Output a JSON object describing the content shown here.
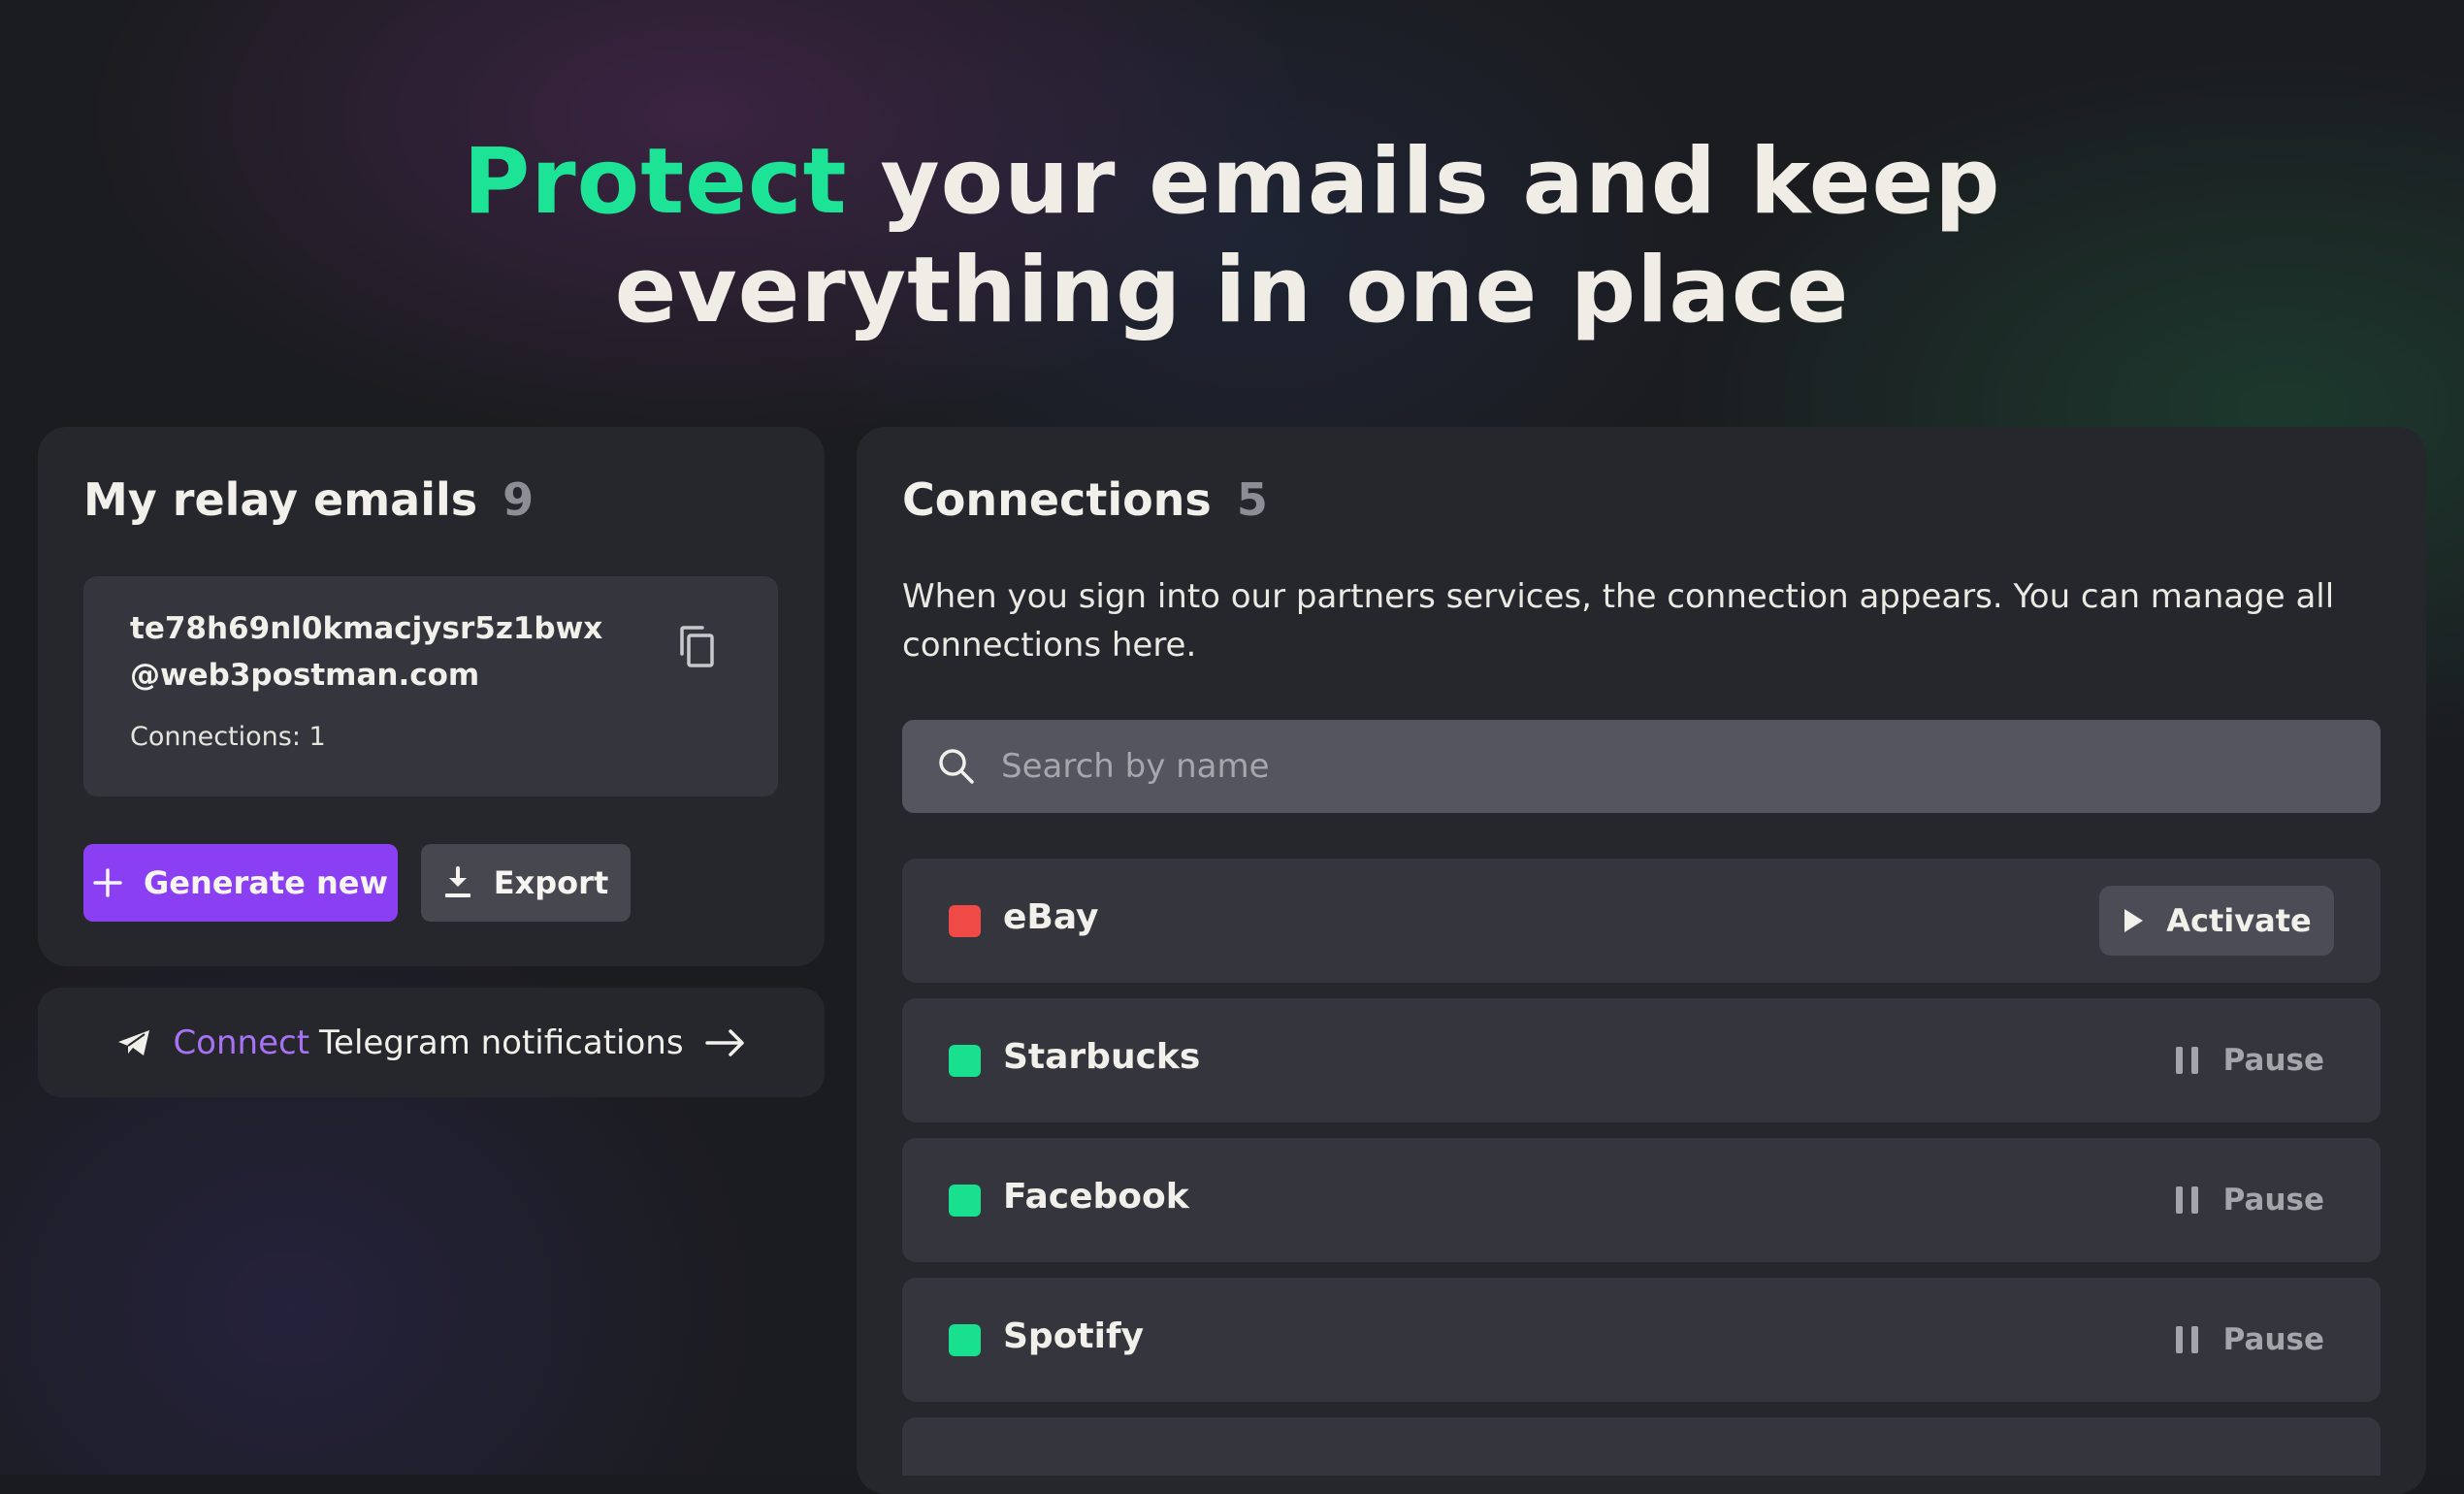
{
  "hero": {
    "accent_word": "Protect",
    "line1_rest": "your emails and keep",
    "line2": "everything in one place"
  },
  "relay": {
    "title": "My relay emails",
    "count": "9",
    "email_line1": "te78h69nl0kmacjysr5z1bwx",
    "email_line2": "@web3postman.com",
    "connections_label": "Connections: 1",
    "generate_label": "Generate new",
    "export_label": "Export"
  },
  "telegram": {
    "connect_word": "Connect",
    "rest": "Telegram notifications"
  },
  "connections": {
    "title": "Connections",
    "count": "5",
    "description": "When you sign into our partners services, the connection appears. You can manage all connections here.",
    "search_placeholder": "Search by name",
    "items": [
      {
        "name": "eBay",
        "status_color": "#f04a47",
        "action": "Activate"
      },
      {
        "name": "Starbucks",
        "status_color": "#19e08f",
        "action": "Pause"
      },
      {
        "name": "Facebook",
        "status_color": "#19e08f",
        "action": "Pause"
      },
      {
        "name": "Spotify",
        "status_color": "#19e08f",
        "action": "Pause"
      }
    ]
  },
  "colors": {
    "accent_green": "#1de396",
    "accent_purple": "#8b3ff2",
    "card_bg": "#26272c"
  }
}
